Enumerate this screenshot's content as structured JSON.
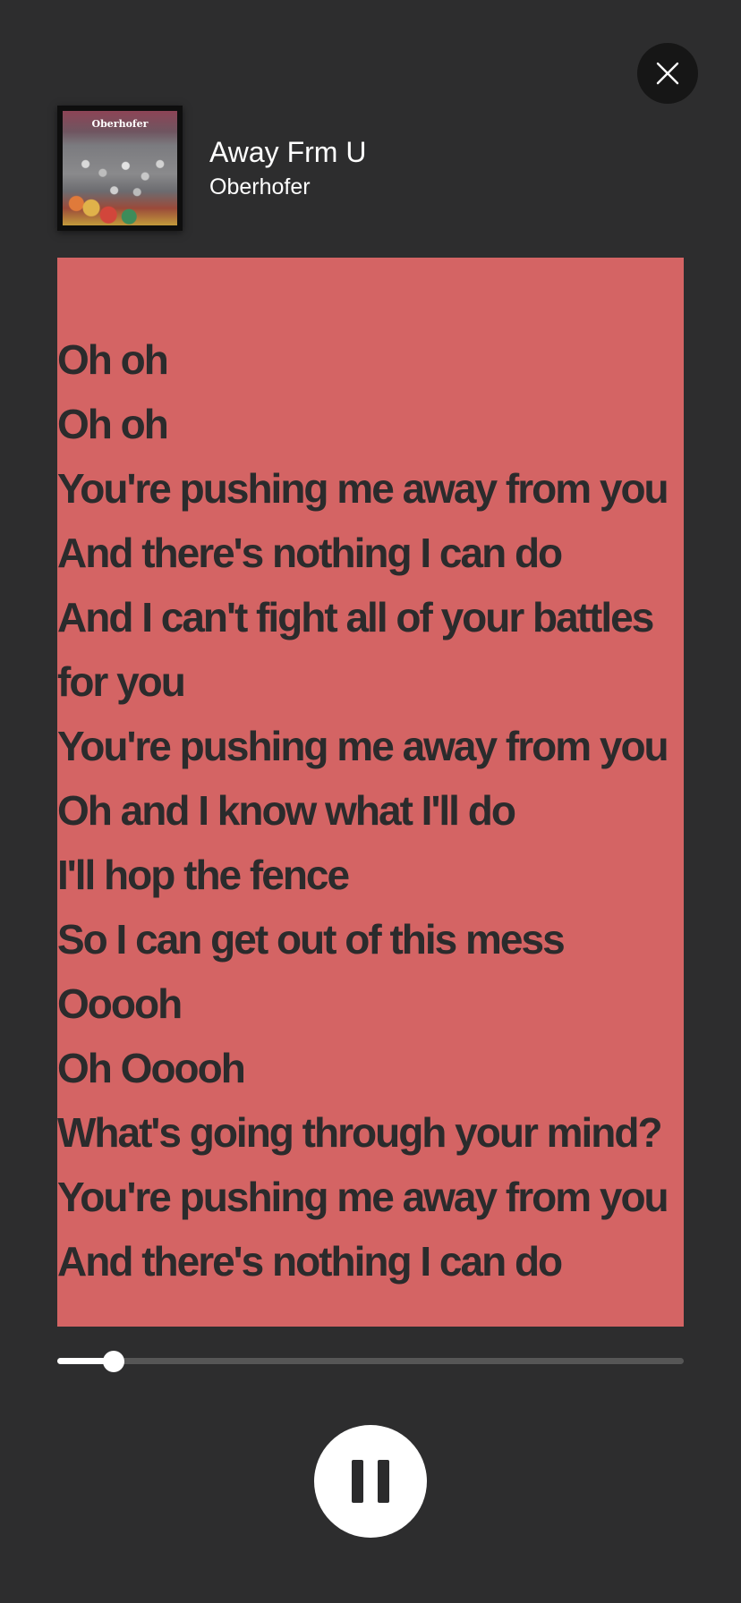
{
  "header": {
    "title": "Away Frm U",
    "artist": "Oberhofer",
    "album_art_text": "Oberhofer"
  },
  "lyrics": [
    "Oh oh",
    "Oh oh",
    "You're pushing me away from you",
    "And there's nothing I can do",
    "And I can't fight all of your battles for you",
    "You're pushing me away from you",
    "Oh and I know what I'll do",
    "I'll hop the fence",
    "So I can get out of this mess",
    "Ooooh",
    "Oh Ooooh",
    "What's going through your mind?",
    "You're pushing me away from you",
    "And there's nothing I can do"
  ],
  "playback": {
    "progress_fraction": 0.09,
    "state": "playing"
  },
  "icons": {
    "close": "close-icon",
    "pause": "pause-icon"
  },
  "colors": {
    "background": "#2d2d2e",
    "lyrics_card": "#d46464",
    "lyrics_text": "#2b2b2c"
  }
}
